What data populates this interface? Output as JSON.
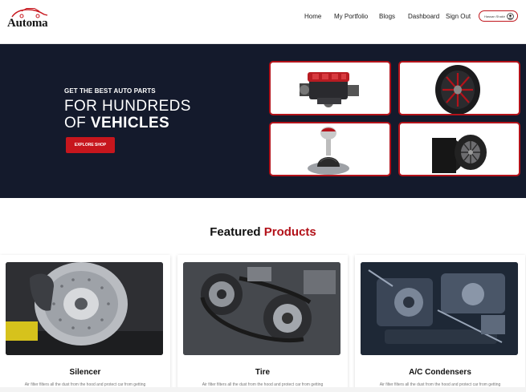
{
  "brand": {
    "name": "Automa",
    "logo_icon": "car-outline-icon"
  },
  "nav": {
    "items": [
      {
        "label": "Home"
      },
      {
        "label": "My Portfolio"
      },
      {
        "label": "Blogs"
      },
      {
        "label": "Dashboard"
      },
      {
        "label": "Sign Out"
      }
    ],
    "profile": {
      "name": "Hassan Shakir",
      "icon": "user-circle-icon"
    }
  },
  "hero": {
    "kicker": "GET THE BEST AUTO PARTS",
    "line1": "FOR HUNDREDS",
    "line2_prefix": "OF ",
    "line2_strong": "VEHICLES",
    "cta_label": "EXPLORE SHOP",
    "accent_color": "#c7161d",
    "background_color": "#141a2c",
    "part_images": [
      "engine-image",
      "wheel-rim-image",
      "gear-shifter-image",
      "tires-image"
    ]
  },
  "featured": {
    "title_plain": "Featured ",
    "title_accent": "Products",
    "products": [
      {
        "name": "Silencer",
        "image": "brake-disc-image",
        "description": "Air filter filters all the dust from the hood and protect car from getting"
      },
      {
        "name": "Tire",
        "image": "engine-belt-image",
        "description": "Air filter filters all the dust from the hood and protect car from getting"
      },
      {
        "name": "A/C Condensers",
        "image": "engine-bay-image",
        "description": "Air filter filters all the dust from the hood and protect car from getting"
      }
    ]
  }
}
